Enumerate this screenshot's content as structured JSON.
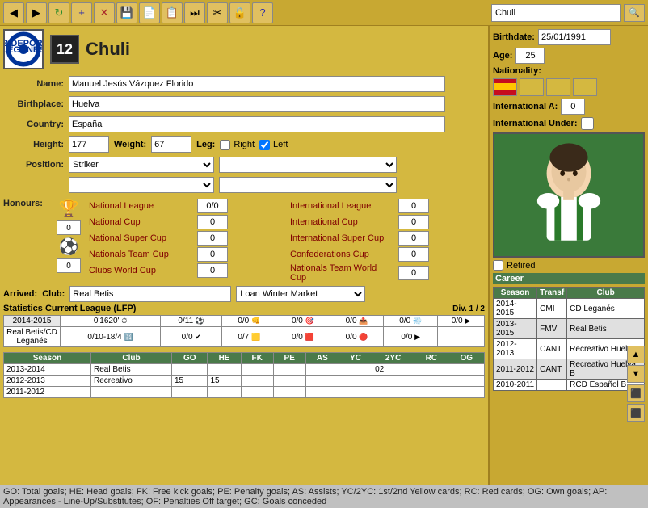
{
  "toolbar": {
    "buttons": [
      "◀",
      "▶",
      "⟳",
      "➕",
      "✕",
      "💾",
      "📋",
      "📋",
      "⏭",
      "✂",
      "🔒",
      "❓"
    ],
    "search_placeholder": "Chuli",
    "search_value": "Chuli"
  },
  "player": {
    "number": "12",
    "name": "Chuli",
    "full_name": "Manuel Jesús Vázquez Florido",
    "birthplace": "Huelva",
    "country": "España",
    "birthdate": "25/01/1991",
    "age": "25",
    "height": "177",
    "weight": "67",
    "right_check": false,
    "left_check": true,
    "position": "Striker",
    "international_a": "0",
    "nationality": "Nationality:"
  },
  "honours": {
    "label": "Honours:",
    "items_left": [
      {
        "name": "National League",
        "value": "0/0"
      },
      {
        "name": "National Cup",
        "value": "0"
      },
      {
        "name": "National Super Cup",
        "value": "0"
      },
      {
        "name": "Nationals Team Cup",
        "value": "0"
      },
      {
        "name": "Clubs World Cup",
        "value": "0"
      }
    ],
    "items_right": [
      {
        "name": "International League",
        "value": "0"
      },
      {
        "name": "International Cup",
        "value": "0"
      },
      {
        "name": "International Super Cup",
        "value": "0"
      },
      {
        "name": "Confederations Cup",
        "value": "0"
      },
      {
        "name": "Nationals Team World Cup",
        "value": "0"
      }
    ]
  },
  "arrived": {
    "label": "Arrived:",
    "club_label": "Club:",
    "club_value": "Real Betis",
    "market": "Loan Winter Market"
  },
  "stats": {
    "title": "Statistics Current League (LFP)",
    "div": "Div. 1 / 2",
    "row1": {
      "season": "2014-2015",
      "time": "0'1620'",
      "goals": "0/11",
      "tackles": "0/0",
      "headers": "0/0",
      "passes": "0/0",
      "shots": "0/0",
      "other": "0/0"
    },
    "team_row": {
      "team": "Real Betis/CD Leganés",
      "record": "0/10-18/4",
      "val1": "0/0",
      "val2": "0/7",
      "val3": "0/0",
      "val4": "0/0",
      "val5": "0/0"
    }
  },
  "season_history": {
    "headers": [
      "Season",
      "Club",
      "GO",
      "HE",
      "FK",
      "PE",
      "AS",
      "YC",
      "2YC",
      "RC",
      "OG"
    ],
    "rows": [
      {
        "season": "2013-2014",
        "club": "Real Betis",
        "go": "",
        "he": "",
        "fk": "",
        "pe": "",
        "as": "",
        "yc": "",
        "zyc": "02",
        "rc": "",
        "og": ""
      },
      {
        "season": "2012-2013",
        "club": "Recreativo",
        "go": "15",
        "he": "15",
        "fk": "",
        "pe": "",
        "as": "",
        "yc": "",
        "zyc": "",
        "rc": "",
        "og": ""
      },
      {
        "season": "2011-2012",
        "club": "",
        "go": "",
        "he": "",
        "fk": "",
        "pe": "",
        "as": "",
        "yc": "",
        "zyc": "",
        "rc": "",
        "og": ""
      }
    ]
  },
  "career": {
    "title": "Career",
    "headers": [
      "Season",
      "Transf",
      "Club"
    ],
    "rows": [
      {
        "season": "2014-2015",
        "transfer": "CMI",
        "club": "CD Leganés"
      },
      {
        "season": "2013-2015",
        "transfer": "FMV",
        "club": "Real Betis"
      },
      {
        "season": "2012-2013",
        "transfer": "CANT",
        "club": "Recreativo Huelva"
      },
      {
        "season": "2011-2012",
        "transfer": "CANT",
        "club": "Recreativo Huelva B"
      },
      {
        "season": "2010-2011",
        "transfer": "",
        "club": "RCD Español B"
      }
    ]
  },
  "footer": {
    "text": "GO: Total goals; HE: Head goals; FK: Free kick goals; PE: Penalty goals; AS: Assists; YC/2YC: 1st/2nd Yellow cards; RC: Red cards; OG: Own goals; AP: Appearances - Line-Up/Substitutes; OF: Penalties Off target; GC: Goals conceded"
  }
}
